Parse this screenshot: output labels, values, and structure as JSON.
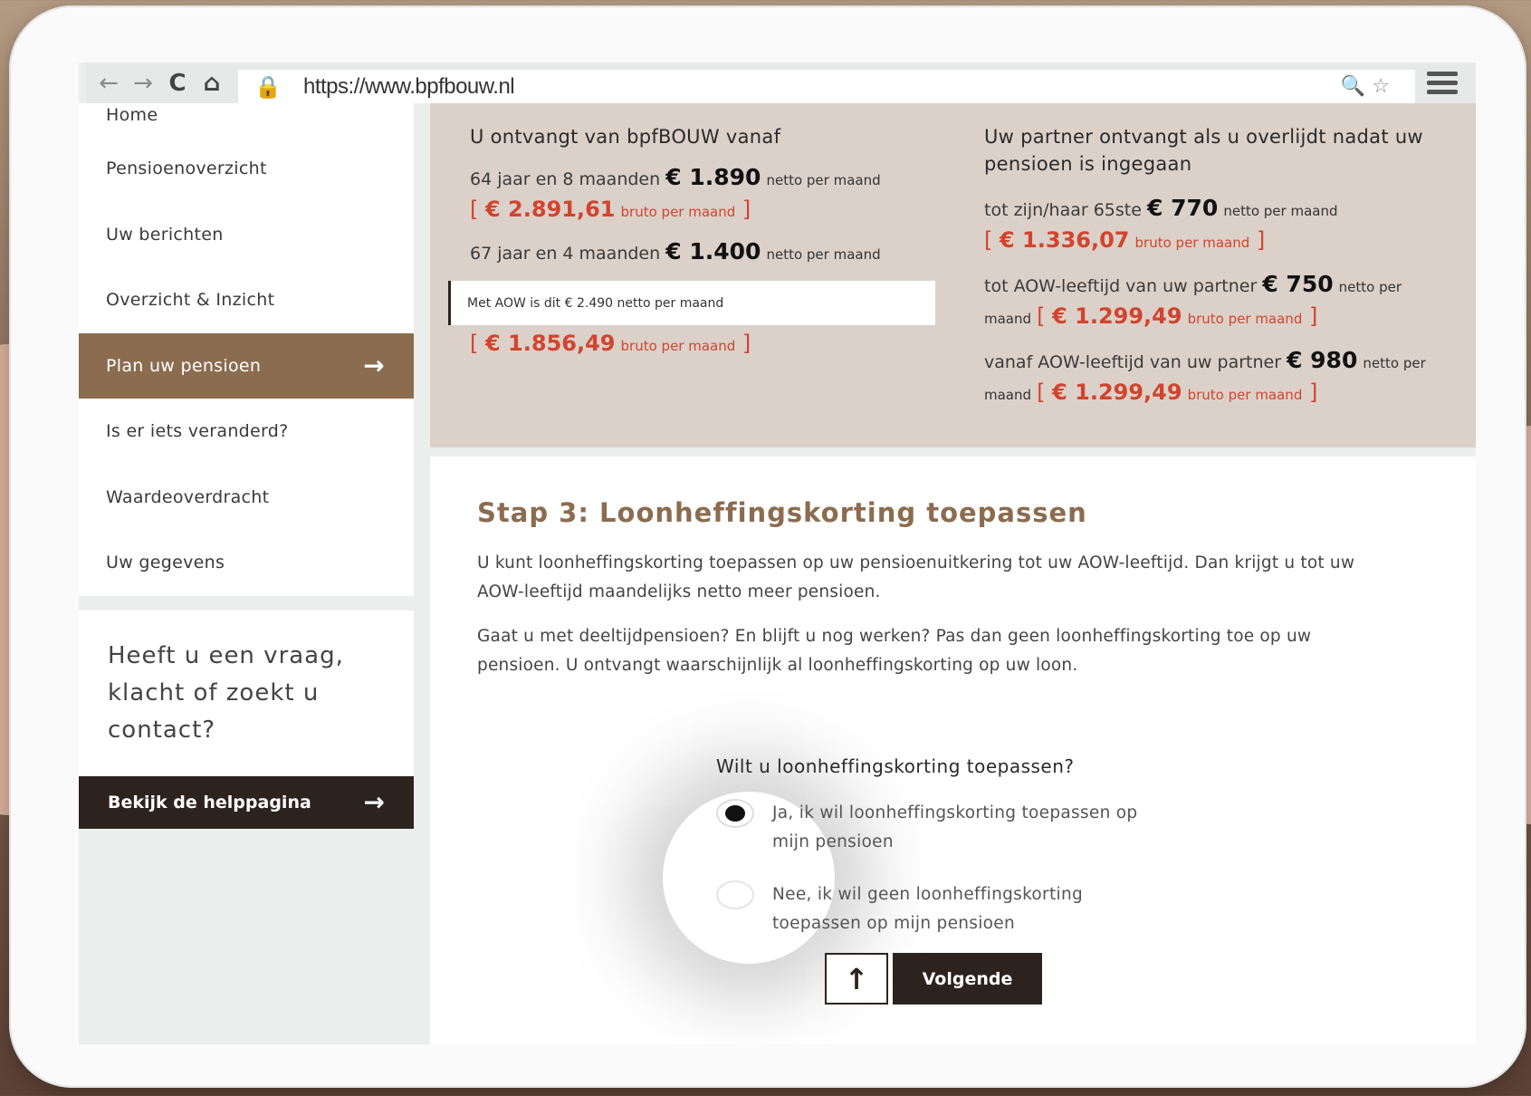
{
  "browser": {
    "url": "https://www.bpfbouw.nl",
    "back_icon": "←",
    "forward_icon": "→",
    "reload_icon": "C",
    "home_icon": "⌂"
  },
  "sidebar": {
    "items": [
      {
        "label": "Home"
      },
      {
        "label": "Pensioenoverzicht"
      },
      {
        "label": "Uw berichten"
      },
      {
        "label": "Overzicht & Inzicht"
      },
      {
        "label": "Plan uw pensioen",
        "active": true
      },
      {
        "label": "Is er iets veranderd?"
      },
      {
        "label": "Waardeoverdracht"
      },
      {
        "label": "Uw gegevens"
      }
    ],
    "help_text": "Heeft u een vraag, klacht of zoekt u contact?",
    "help_button": "Bekijk de helppagina",
    "arrow": "→"
  },
  "summary": {
    "left": {
      "heading": "U ontvangt van bpfBOUW vanaf",
      "row1_prefix": "64 jaar en 8 maanden",
      "row1_amount": "€ 1.890",
      "row1_unit": "netto per maand",
      "row1_bruto": "€ 2.891,61",
      "row1_bruto_unit": "bruto per maand",
      "row2_prefix": "67 jaar en 4 maanden",
      "row2_amount": "€ 1.400",
      "row2_unit": "netto per maand",
      "aow_note": "Met AOW is dit  € 2.490 netto per maand",
      "row2_bruto": "€ 1.856,49",
      "row2_bruto_unit": "bruto per maand"
    },
    "right": {
      "heading": "Uw partner ontvangt als u overlijdt nadat uw pensioen is ingegaan",
      "row1_prefix": "tot zijn/haar 65ste",
      "row1_amount": "€ 770",
      "row1_unit": "netto per maand",
      "row1_bruto": "€ 1.336,07",
      "row1_bruto_unit": "bruto per maand",
      "row2_prefix": "tot AOW-leeftijd van uw partner",
      "row2_amount": "€ 750",
      "row2_unit_a": "netto per",
      "row2_unit_b": "maand",
      "row2_bruto": "€ 1.299,49",
      "row2_bruto_unit": "bruto per maand",
      "row3_prefix": "vanaf AOW-leeftijd van uw partner",
      "row3_amount": "€ 980",
      "row3_unit_a": "netto per",
      "row3_unit_b": "maand",
      "row3_bruto": "€ 1.299,49",
      "row3_bruto_unit": "bruto per maand"
    }
  },
  "step": {
    "title": "Stap 3: Loonheffingskorting toepassen",
    "para1": "U kunt loonheffingskorting toepassen op uw pensioenuitkering tot uw AOW-leeftijd. Dan krijgt u tot uw AOW-leeftijd maandelijks netto meer pensioen.",
    "para2": "Gaat u met deeltijdpensioen? En blijft u nog werken? Pas dan geen loonheffingskorting toe op uw pensioen. U ontvangt waarschijnlijk al loonheffingskorting op uw loon.",
    "question": "Wilt u loonheffingskorting toepassen?",
    "option_yes": "Ja, ik wil loonheffingskorting toepassen op mijn pensioen",
    "option_no": "Nee, ik wil geen loonheffingskorting toepassen op mijn pensioen",
    "selected": "yes",
    "up_icon": "↑",
    "next_label": "Volgende"
  }
}
